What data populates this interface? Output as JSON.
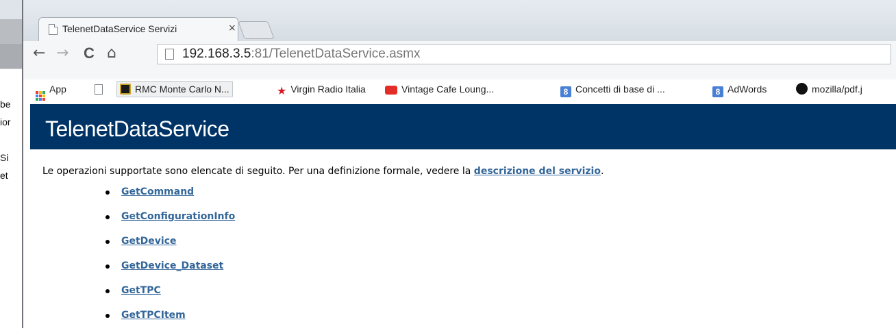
{
  "background_window": {
    "text_fragments": [
      "be",
      "ior",
      "Si",
      "et"
    ]
  },
  "browser": {
    "tab": {
      "title": "TelenetDataService Servizi",
      "close": "×"
    },
    "nav": {
      "back": "←",
      "forward": "→",
      "reload": "C",
      "home": "⌂"
    },
    "url": {
      "host": "192.168.3.5",
      "rest": ":81/TelenetDataService.asmx"
    },
    "bookmarks": [
      {
        "label": "App",
        "icon": "apps-grid-icon"
      },
      {
        "label": "",
        "icon": "blank-page-icon"
      },
      {
        "label": "RMC Monte Carlo N...",
        "icon": "rmc-icon"
      },
      {
        "label": "Virgin Radio Italia",
        "icon": "virgin-star-icon"
      },
      {
        "label": "Vintage Cafe Loung...",
        "icon": "youtube-icon"
      },
      {
        "label": "Concetti di base di ...",
        "icon": "google-icon"
      },
      {
        "label": "AdWords",
        "icon": "google-icon"
      },
      {
        "label": "mozilla/pdf.j",
        "icon": "github-icon"
      }
    ]
  },
  "page": {
    "title": "TelenetDataService",
    "intro_text": "Le operazioni supportate sono elencate di seguito. Per una definizione formale, vedere la ",
    "intro_link": "descrizione del servizio",
    "intro_end": ".",
    "operations": [
      "GetCommand",
      "GetConfigurationInfo",
      "GetDevice",
      "GetDevice_Dataset",
      "GetTPC",
      "GetTPCItem"
    ]
  },
  "colors": {
    "header_bg": "#003366",
    "link": "#336699"
  }
}
